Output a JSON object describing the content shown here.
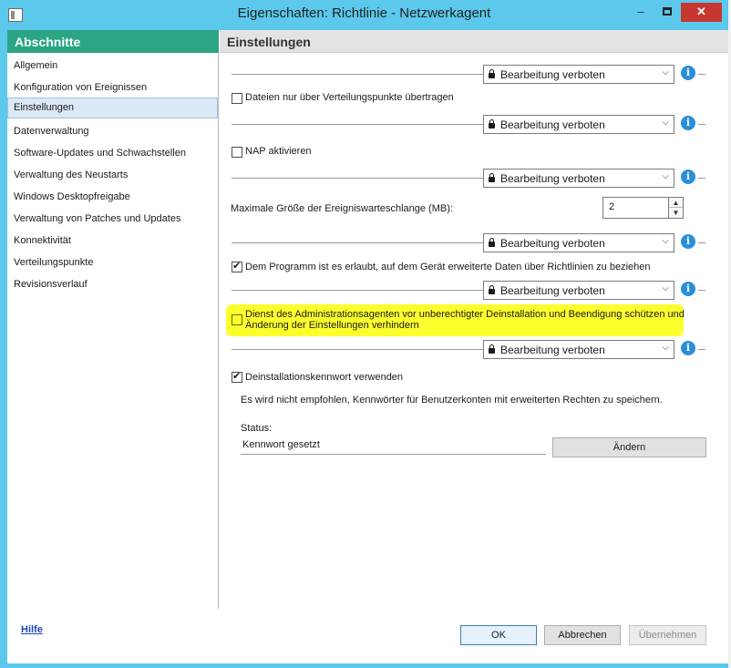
{
  "window": {
    "title": "Eigenschaften: Richtlinie - Netzwerkagent",
    "minimize_glyph": "–",
    "close_glyph": "✕"
  },
  "sidebar": {
    "heading": "Abschnitte",
    "items": [
      {
        "label": "Allgemein"
      },
      {
        "label": "Konfiguration von Ereignissen"
      },
      {
        "label": "Einstellungen"
      },
      {
        "label": "Datenverwaltung"
      },
      {
        "label": "Software-Updates und Schwachstellen"
      },
      {
        "label": "Verwaltung des Neustarts"
      },
      {
        "label": "Windows Desktopfreigabe"
      },
      {
        "label": "Verwaltung von Patches und Updates"
      },
      {
        "label": "Konnektivität"
      },
      {
        "label": "Verteilungspunkte"
      },
      {
        "label": "Revisionsverlauf"
      }
    ],
    "selected_index": 2,
    "help_link": "Hilfe"
  },
  "main": {
    "heading": "Einstellungen",
    "lock_dropdown_value": "Bearbeitung verboten",
    "info_glyph": "i",
    "settings": {
      "dist_points_only": {
        "label": "Dateien nur über Verteilungspunkte übertragen",
        "checked": false
      },
      "nap": {
        "label": "NAP aktivieren",
        "checked": false
      },
      "queue_size": {
        "label": "Maximale Größe der Ereigniswarteschlange (MB):",
        "value": "2"
      },
      "extended_data": {
        "label": "Dem Programm ist es erlaubt, auf dem Gerät erweiterte Daten über Richtlinien zu beziehen",
        "checked": true
      },
      "protect_service": {
        "label_line1": "Dienst des Administrationsagenten vor unberechtigter Deinstallation und Beendigung schützen und",
        "label_line2": "Änderung der Einstellungen verhindern",
        "checked": false,
        "highlight_color": "#fbff2b"
      },
      "uninstall_password": {
        "label": "Deinstallationskennwort verwenden",
        "checked": true,
        "note": "Es wird nicht empfohlen, Kennwörter für Benutzerkonten mit erweiterten Rechten zu speichern.",
        "status_label": "Status:",
        "status_value": "Kennwort gesetzt",
        "change_button": "Ändern"
      }
    }
  },
  "footer": {
    "ok": "OK",
    "cancel": "Abbrechen",
    "apply": "Übernehmen"
  },
  "colors": {
    "title_bar": "#5bc8ec",
    "sidebar_header": "#2ba583",
    "close_button": "#c7372f",
    "info_icon": "#2a8fd8"
  }
}
